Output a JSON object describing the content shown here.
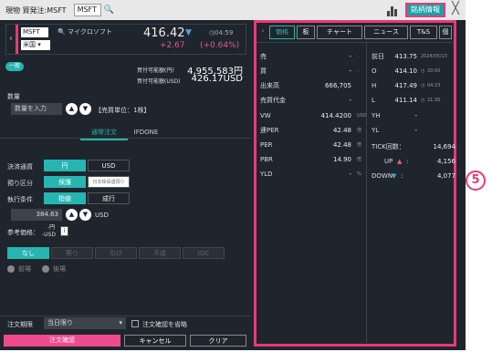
{
  "titlebar": {
    "title": "現物 買発注:MSFT",
    "symbol": "MSFT",
    "info_button": "銘柄情報",
    "close": "╳"
  },
  "quote": {
    "symbol": "MSFT",
    "name": "マイクロソフト",
    "market": "米国",
    "price": "416.42",
    "time": "04:59",
    "change": "+2.67",
    "change_pct": "(+0.64%)"
  },
  "account": {
    "type": "一般",
    "bp_label1": "買付可能額(円)",
    "bp_value1": "4,955,583円",
    "bp_label2": "買付可能額(USD)",
    "bp_value2": "426.17USD"
  },
  "order": {
    "qty_label": "数量",
    "qty_placeholder": "数量を入力",
    "unit_text": "【売買単位：1株】",
    "tab_normal": "通常注文",
    "tab_ifdone": "IFDONE",
    "currency_label": "決済通貨",
    "cur_jpy": "円",
    "cur_usd": "USD",
    "deposit_label": "預り区分",
    "deposit_on": "保護",
    "deposit_off": "日本株保護預り",
    "exec_label": "執行条件",
    "exec_limit": "指値",
    "exec_market": "成行",
    "price_value": "384.63",
    "price_unit": "USD",
    "ref_label": "参考価格：",
    "ref_line1": "-円",
    "ref_line2": "-USD",
    "cond": [
      "なし",
      "寄り",
      "引け",
      "不成",
      "IOC"
    ],
    "session": [
      "前場",
      "後場"
    ],
    "expiry_label": "注文期限",
    "expiry_value": "当日限り",
    "skip_confirm": "注文確認を省略",
    "btn_confirm": "注文確認",
    "btn_cancel": "キャンセル",
    "btn_clear": "クリア"
  },
  "info": {
    "tabs": [
      "価格",
      "板",
      "チャート",
      "ニュース",
      "T&S",
      "個"
    ],
    "left_rows": [
      {
        "label": "売",
        "value": "-",
        "unit": "-"
      },
      {
        "label": "買",
        "value": "-",
        "unit": "-"
      },
      {
        "label": "出来高",
        "value": "666,705",
        "unit": ""
      },
      {
        "label": "売買代金",
        "value": "-",
        "unit": ""
      },
      {
        "label": "VW",
        "value": "414.4200",
        "unit": "USD"
      },
      {
        "label": "連PER",
        "value": "42.48",
        "unit": "倍"
      },
      {
        "label": "PER",
        "value": "42.48",
        "unit": "倍"
      },
      {
        "label": "PBR",
        "value": "14.90",
        "unit": "倍"
      },
      {
        "label": "YLD",
        "value": "-",
        "unit": "%"
      }
    ],
    "right_rows": [
      {
        "label": "前日",
        "value": "413.75",
        "note": "2024/05/13"
      },
      {
        "label": "O",
        "value": "414.10",
        "note": "20:00"
      },
      {
        "label": "H",
        "value": "417.49",
        "note": "04:23"
      },
      {
        "label": "L",
        "value": "411.14",
        "note": "21:30"
      },
      {
        "label": "YH",
        "value": "-",
        "note": ""
      },
      {
        "label": "YL",
        "value": "-",
        "note": ""
      }
    ],
    "tick_label": "TICK回数：",
    "tick_value": "14,694",
    "up_label": "UP",
    "up_value": "4,156",
    "down_label": "DOWN",
    "down_value": "4,077"
  },
  "annotation": "5"
}
